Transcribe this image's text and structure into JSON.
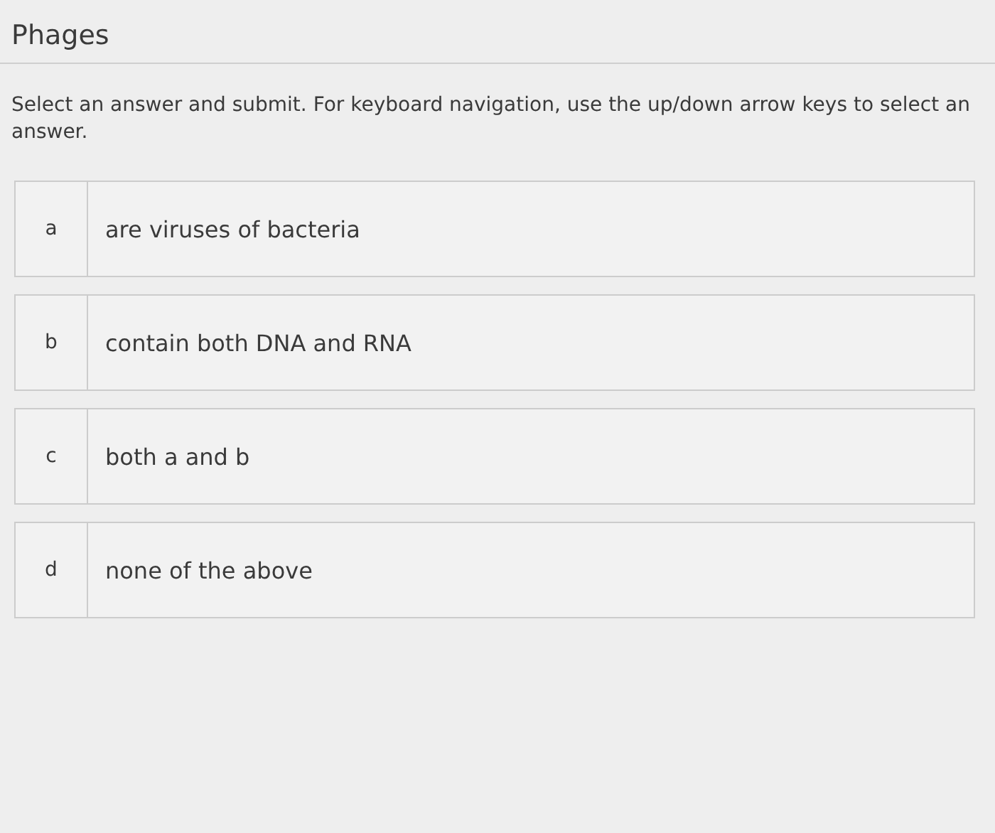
{
  "title": "Phages",
  "instructions": "Select an answer and submit. For keyboard navigation, use the up/down arrow keys to select an answer.",
  "options": [
    {
      "letter": "a",
      "text": "are viruses of bacteria",
      "selected": false
    },
    {
      "letter": "b",
      "text": "contain both DNA and RNA",
      "selected": false
    },
    {
      "letter": "c",
      "text": "both a and b",
      "selected": false
    },
    {
      "letter": "d",
      "text": "none of the above",
      "selected": false
    }
  ]
}
